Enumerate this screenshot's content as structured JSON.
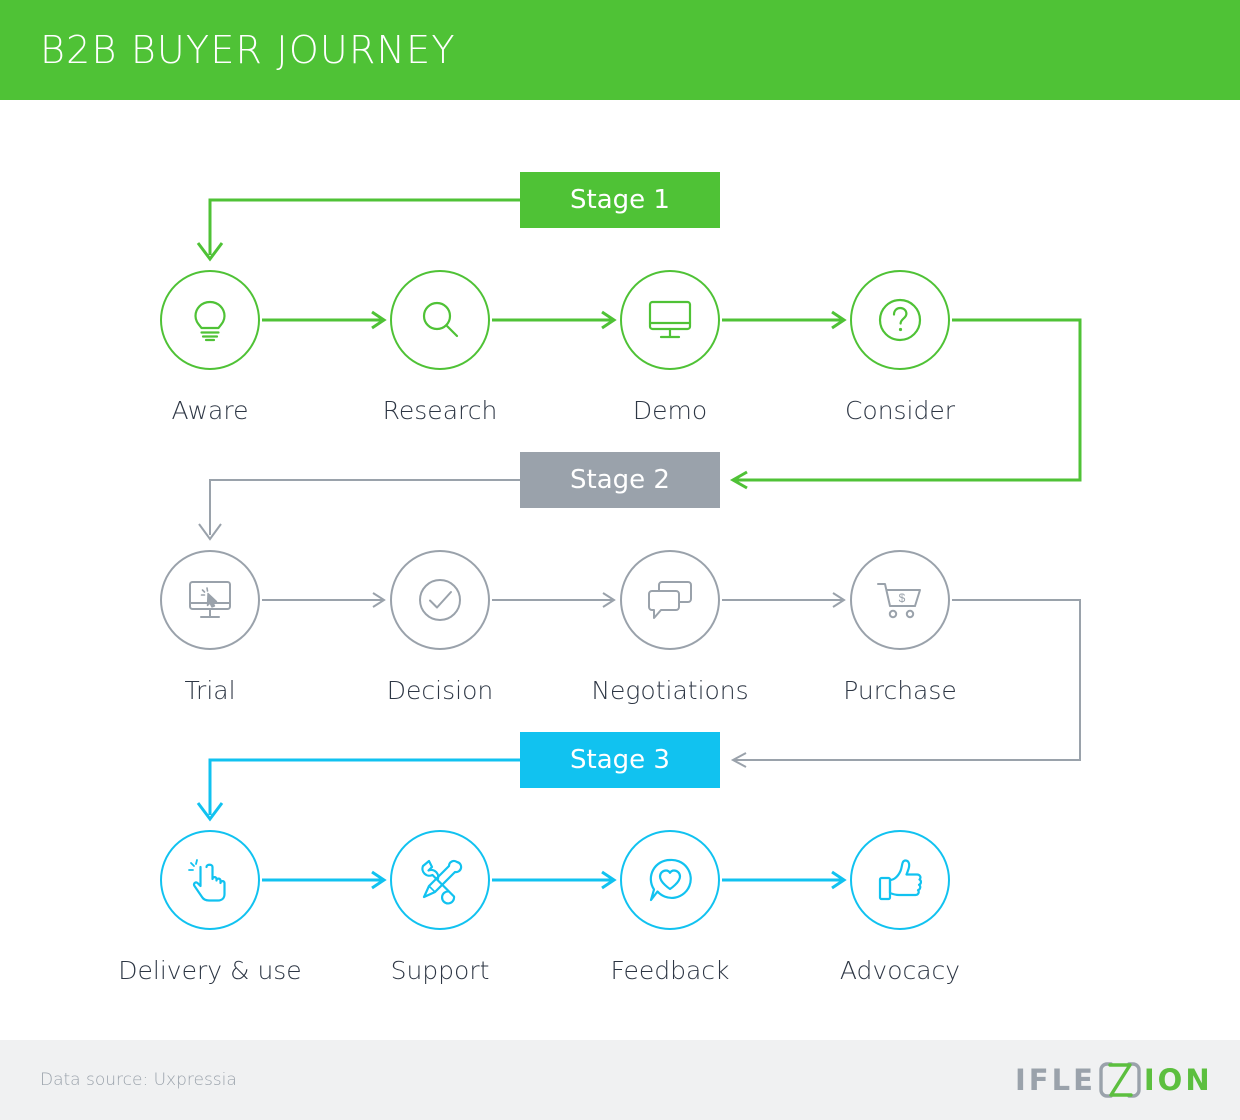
{
  "header": {
    "title": "B2B BUYER JOURNEY",
    "bg_color": "#4FC236"
  },
  "colors": {
    "green": "#4FC236",
    "gray": "#9aa2ab",
    "cyan": "#11C2F0",
    "label": "#2d3644",
    "footer_bg": "#f0f1f2"
  },
  "diagram": {
    "rows": [
      {
        "badge": {
          "label": "Stage 1",
          "color": "#4FC236"
        },
        "accent": "#4FC236",
        "nodes": [
          {
            "label": "Aware",
            "icon": "lightbulb-icon"
          },
          {
            "label": "Research",
            "icon": "magnifier-icon"
          },
          {
            "label": "Demo",
            "icon": "monitor-icon"
          },
          {
            "label": "Consider",
            "icon": "question-mark-icon"
          }
        ]
      },
      {
        "badge": {
          "label": "Stage 2",
          "color": "#9aa2ab"
        },
        "accent": "#9aa2ab",
        "nodes": [
          {
            "label": "Trial",
            "icon": "monitor-cursor-icon"
          },
          {
            "label": "Decision",
            "icon": "check-circle-icon"
          },
          {
            "label": "Negotiations",
            "icon": "speech-bubbles-icon"
          },
          {
            "label": "Purchase",
            "icon": "shopping-cart-dollar-icon"
          }
        ]
      },
      {
        "badge": {
          "label": "Stage 3",
          "color": "#11C2F0"
        },
        "accent": "#11C2F0",
        "nodes": [
          {
            "label": "Delivery & use",
            "icon": "tap-hand-icon"
          },
          {
            "label": "Support",
            "icon": "wrench-screwdriver-icon"
          },
          {
            "label": "Feedback",
            "icon": "heart-bubble-icon"
          },
          {
            "label": "Advocacy",
            "icon": "thumbs-up-icon"
          }
        ]
      }
    ]
  },
  "footer": {
    "source": "Data source: Uxpressia",
    "logo": {
      "part1": "IFLE",
      "part2": "ION"
    }
  }
}
